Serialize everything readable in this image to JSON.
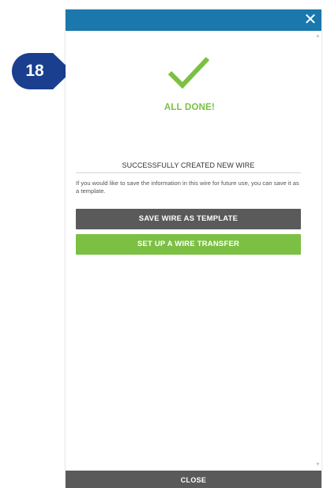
{
  "step_marker": {
    "number": "18",
    "color": "#1b3f8f"
  },
  "modal": {
    "header_color": "#1a78ad",
    "close_icon_glyph": "✕",
    "success_title": "ALL DONE!",
    "success_color": "#7bc043",
    "heading": "SUCCESSFULLY CREATED NEW WIRE",
    "info_text": "If you would like to save the information in this wire for future use, you can save it as a template.",
    "buttons": {
      "save_template": "SAVE WIRE AS TEMPLATE",
      "setup_transfer": "SET UP A WIRE TRANSFER"
    },
    "footer_close": "CLOSE"
  },
  "icons": {
    "check": "check-icon",
    "close": "close-icon",
    "scroll_up": "scroll-up-arrow-icon",
    "scroll_down": "scroll-down-arrow-icon"
  }
}
